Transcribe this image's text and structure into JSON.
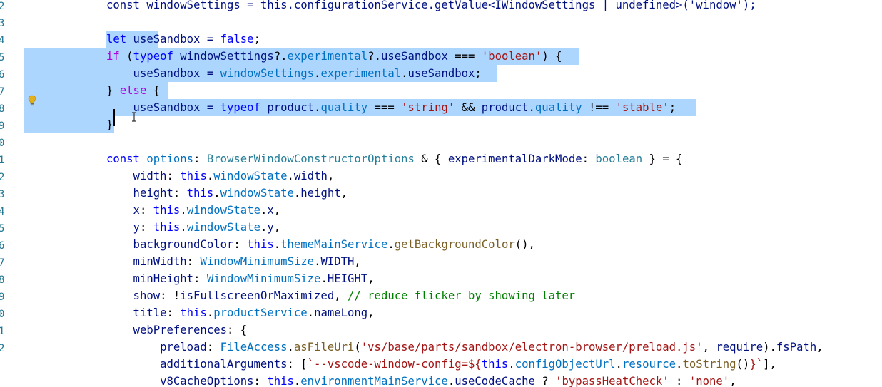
{
  "editor": {
    "gutter": [
      "2",
      "3",
      "4",
      "5",
      "6",
      "7",
      "8",
      "9",
      "0",
      "1",
      "2",
      "3",
      "4",
      "5",
      "6",
      "7",
      "8",
      "9",
      "0",
      "1",
      "2"
    ],
    "lines": [
      [
        [
          "const windowSettings = this.configurationService.getValue<IWindowSettings | undefined>('window');",
          "var"
        ]
      ],
      [],
      [
        [
          "let",
          "kw"
        ],
        [
          " useSandbox = ",
          "var"
        ],
        [
          "false",
          "kw"
        ],
        [
          ";",
          "punc"
        ]
      ],
      [
        [
          "if",
          "ctl"
        ],
        [
          " (",
          "punc"
        ],
        [
          "typeof",
          "kw"
        ],
        [
          " windowSettings",
          "var"
        ],
        [
          "?.",
          "punc"
        ],
        [
          "experimental",
          "prop"
        ],
        [
          "?.",
          "punc"
        ],
        [
          "useSandbox",
          "var"
        ],
        [
          " === ",
          "punc"
        ],
        [
          "'boolean'",
          "str"
        ],
        [
          ") {",
          "punc"
        ]
      ],
      [
        [
          "    useSandbox = ",
          "var"
        ],
        [
          "windowSettings",
          "prop"
        ],
        [
          ".",
          "punc"
        ],
        [
          "experimental",
          "prop"
        ],
        [
          ".",
          "punc"
        ],
        [
          "useSandbox",
          "var"
        ],
        [
          ";",
          "punc"
        ]
      ],
      [
        [
          "} ",
          "punc"
        ],
        [
          "else",
          "ctl"
        ],
        [
          " {",
          "punc"
        ]
      ],
      [
        [
          "    useSandbox = ",
          "var"
        ],
        [
          "typeof",
          "kw"
        ],
        [
          " ",
          "punc"
        ],
        [
          "product",
          "var",
          "strike"
        ],
        [
          ".",
          "punc"
        ],
        [
          "quality",
          "prop"
        ],
        [
          " === ",
          "punc"
        ],
        [
          "'string'",
          "str"
        ],
        [
          " && ",
          "punc"
        ],
        [
          "product",
          "var",
          "strike"
        ],
        [
          ".",
          "punc"
        ],
        [
          "quality",
          "prop"
        ],
        [
          " !== ",
          "punc"
        ],
        [
          "'stable'",
          "str"
        ],
        [
          ";",
          "punc"
        ]
      ],
      [
        [
          "}",
          "punc"
        ]
      ],
      [],
      [
        [
          "const",
          "kw"
        ],
        [
          " options",
          "prop"
        ],
        [
          ": ",
          "punc"
        ],
        [
          "BrowserWindowConstructorOptions",
          "type"
        ],
        [
          " & { ",
          "punc"
        ],
        [
          "experimentalDarkMode",
          "var"
        ],
        [
          ": ",
          "punc"
        ],
        [
          "boolean",
          "type"
        ],
        [
          " } = {",
          "punc"
        ]
      ],
      [
        [
          "    width",
          "var"
        ],
        [
          ": ",
          "punc"
        ],
        [
          "this",
          "kw"
        ],
        [
          ".",
          "punc"
        ],
        [
          "windowState",
          "prop"
        ],
        [
          ".",
          "punc"
        ],
        [
          "width",
          "var"
        ],
        [
          ",",
          "punc"
        ]
      ],
      [
        [
          "    height",
          "var"
        ],
        [
          ": ",
          "punc"
        ],
        [
          "this",
          "kw"
        ],
        [
          ".",
          "punc"
        ],
        [
          "windowState",
          "prop"
        ],
        [
          ".",
          "punc"
        ],
        [
          "height",
          "var"
        ],
        [
          ",",
          "punc"
        ]
      ],
      [
        [
          "    x",
          "var"
        ],
        [
          ": ",
          "punc"
        ],
        [
          "this",
          "kw"
        ],
        [
          ".",
          "punc"
        ],
        [
          "windowState",
          "prop"
        ],
        [
          ".",
          "punc"
        ],
        [
          "x",
          "var"
        ],
        [
          ",",
          "punc"
        ]
      ],
      [
        [
          "    y",
          "var"
        ],
        [
          ": ",
          "punc"
        ],
        [
          "this",
          "kw"
        ],
        [
          ".",
          "punc"
        ],
        [
          "windowState",
          "prop"
        ],
        [
          ".",
          "punc"
        ],
        [
          "y",
          "var"
        ],
        [
          ",",
          "punc"
        ]
      ],
      [
        [
          "    backgroundColor",
          "var"
        ],
        [
          ": ",
          "punc"
        ],
        [
          "this",
          "kw"
        ],
        [
          ".",
          "punc"
        ],
        [
          "themeMainService",
          "prop"
        ],
        [
          ".",
          "punc"
        ],
        [
          "getBackgroundColor",
          "fn"
        ],
        [
          "(),",
          "punc"
        ]
      ],
      [
        [
          "    minWidth",
          "var"
        ],
        [
          ": ",
          "punc"
        ],
        [
          "WindowMinimumSize",
          "prop"
        ],
        [
          ".",
          "punc"
        ],
        [
          "WIDTH",
          "var"
        ],
        [
          ",",
          "punc"
        ]
      ],
      [
        [
          "    minHeight",
          "var"
        ],
        [
          ": ",
          "punc"
        ],
        [
          "WindowMinimumSize",
          "prop"
        ],
        [
          ".",
          "punc"
        ],
        [
          "HEIGHT",
          "var"
        ],
        [
          ",",
          "punc"
        ]
      ],
      [
        [
          "    show",
          "var"
        ],
        [
          ": !",
          "punc"
        ],
        [
          "isFullscreenOrMaximized",
          "var"
        ],
        [
          ", ",
          "punc"
        ],
        [
          "// reduce flicker by showing later",
          "cmt"
        ]
      ],
      [
        [
          "    title",
          "var"
        ],
        [
          ": ",
          "punc"
        ],
        [
          "this",
          "kw"
        ],
        [
          ".",
          "punc"
        ],
        [
          "productService",
          "prop"
        ],
        [
          ".",
          "punc"
        ],
        [
          "nameLong",
          "var"
        ],
        [
          ",",
          "punc"
        ]
      ],
      [
        [
          "    webPreferences",
          "var"
        ],
        [
          ": {",
          "punc"
        ]
      ],
      [
        [
          "        preload",
          "var"
        ],
        [
          ": ",
          "punc"
        ],
        [
          "FileAccess",
          "prop"
        ],
        [
          ".",
          "punc"
        ],
        [
          "asFileUri",
          "fn"
        ],
        [
          "(",
          "punc"
        ],
        [
          "'vs/base/parts/sandbox/electron-browser/preload.js'",
          "str"
        ],
        [
          ", ",
          "punc"
        ],
        [
          "require",
          "var"
        ],
        [
          ").",
          "punc"
        ],
        [
          "fsPath",
          "var"
        ],
        [
          ",",
          "punc"
        ]
      ],
      [
        [
          "        additionalArguments",
          "var"
        ],
        [
          ": [",
          "punc"
        ],
        [
          "`--vscode-window-config=${",
          "str"
        ],
        [
          "this",
          "kw"
        ],
        [
          ".",
          "punc"
        ],
        [
          "configObjectUrl",
          "prop"
        ],
        [
          ".",
          "punc"
        ],
        [
          "resource",
          "prop"
        ],
        [
          ".",
          "punc"
        ],
        [
          "toString",
          "fn"
        ],
        [
          "()",
          "punc"
        ],
        [
          "}`",
          "str"
        ],
        [
          "],",
          "punc"
        ]
      ],
      [
        [
          "        v8CacheOptions",
          "var"
        ],
        [
          ": ",
          "punc"
        ],
        [
          "this",
          "kw"
        ],
        [
          ".",
          "punc"
        ],
        [
          "environmentMainService",
          "prop"
        ],
        [
          ".",
          "punc"
        ],
        [
          "useCodeCache",
          "var"
        ],
        [
          " ? ",
          "punc"
        ],
        [
          "'bypassHeatCheck'",
          "str"
        ],
        [
          " : ",
          "punc"
        ],
        [
          "'none'",
          "str"
        ],
        [
          ",",
          "punc"
        ]
      ]
    ]
  },
  "colors": {
    "background": "#ffffff",
    "selection": "#add6ff",
    "keyword": "#0000ff",
    "control": "#af00db",
    "variable": "#001080",
    "property": "#0070c1",
    "type": "#267f99",
    "function": "#795e26",
    "string": "#a31515",
    "comment": "#008000",
    "line_number": "#237893"
  },
  "icons": {
    "lightbulb": "lightbulb-icon",
    "text_cursor": "text-cursor-icon"
  }
}
